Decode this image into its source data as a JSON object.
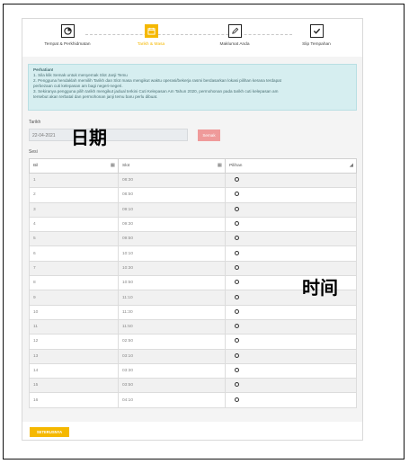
{
  "steps": [
    {
      "label": "Tempat & Perkhidmatan",
      "icon": "location-pin-icon"
    },
    {
      "label": "Tarikh & Masa",
      "icon": "calendar-icon",
      "active": true
    },
    {
      "label": "Maklumat Anda",
      "icon": "pencil-icon"
    },
    {
      "label": "Slip Tempahan",
      "icon": "check-icon"
    }
  ],
  "notice": {
    "title": "Perhatian!",
    "lines": [
      "1. Sila klik Semak untuk menyemak Slot Janji Temu",
      "2. Pengguna hendaklah memilih Tarikh dan Slot masa mengikut waktu operasi/bekerja rasmi berdasarkan lokasi pilihan kerana terdapat",
      "perbezaan cuti kelepasan am bagi negeri-negeri.",
      "3. Sekiranya pengguna pilih tarikh mengikut jadual terkini Cuti Kelepasan Am Tahun 2020, permohonan pada tarikh cuti kelepasan am",
      "tersebut akan terbatal dan permohonan janji temu baru perlu dibuat."
    ]
  },
  "date_field": {
    "label": "Tarikh",
    "value": "22-04-2021",
    "annotation": "日期"
  },
  "check_button": "Semak",
  "session_label": "Sesi",
  "table": {
    "headers": [
      "Bil",
      "Slot",
      "Pilihan"
    ],
    "rows": [
      {
        "bil": "1",
        "slot": "08:30"
      },
      {
        "bil": "2",
        "slot": "08:50"
      },
      {
        "bil": "3",
        "slot": "09:10"
      },
      {
        "bil": "4",
        "slot": "09:30"
      },
      {
        "bil": "5",
        "slot": "09:50"
      },
      {
        "bil": "6",
        "slot": "10:10"
      },
      {
        "bil": "7",
        "slot": "10:30"
      },
      {
        "bil": "8",
        "slot": "10:50"
      },
      {
        "bil": "9",
        "slot": "11:10"
      },
      {
        "bil": "10",
        "slot": "11:30"
      },
      {
        "bil": "11",
        "slot": "11:50"
      },
      {
        "bil": "12",
        "slot": "02:50"
      },
      {
        "bil": "13",
        "slot": "03:10"
      },
      {
        "bil": "14",
        "slot": "03:30"
      },
      {
        "bil": "15",
        "slot": "03:50"
      },
      {
        "bil": "16",
        "slot": "04:10"
      }
    ]
  },
  "time_annotation": "时间",
  "next_button": "SETERUSNYA",
  "colors": {
    "accent": "#f5b800",
    "notice_bg": "#d6eef0",
    "check_button": "#ef9a9a"
  }
}
